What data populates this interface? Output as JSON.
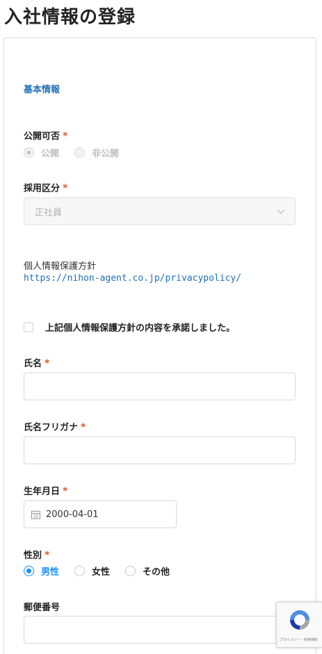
{
  "page": {
    "title": "入社情報の登録"
  },
  "form": {
    "section_title": "基本情報",
    "visibility": {
      "label": "公開可否",
      "required_mark": "*",
      "options": [
        "公開",
        "非公開"
      ],
      "selected": "公開",
      "disabled": true
    },
    "employment_type": {
      "label": "採用区分",
      "required_mark": "*",
      "value": "正社員",
      "disabled": true
    },
    "privacy": {
      "label": "個人情報保護方針",
      "link": "https://nihon-agent.co.jp/privacypolicy/",
      "agree_label": "上記個人情報保護方針の内容を承諾しました。",
      "agreed": false
    },
    "name": {
      "label": "氏名",
      "required_mark": "*",
      "value": ""
    },
    "name_kana": {
      "label": "氏名フリガナ",
      "required_mark": "*",
      "value": ""
    },
    "birth_date": {
      "label": "生年月日",
      "required_mark": "*",
      "value": "2000-04-01"
    },
    "gender": {
      "label": "性別",
      "required_mark": "*",
      "options": [
        "男性",
        "女性",
        "その他"
      ],
      "selected": "男性"
    },
    "postal_code": {
      "label": "郵便番号",
      "value": ""
    }
  },
  "recaptcha": {
    "terms": "プライバシー・利用規約"
  }
}
